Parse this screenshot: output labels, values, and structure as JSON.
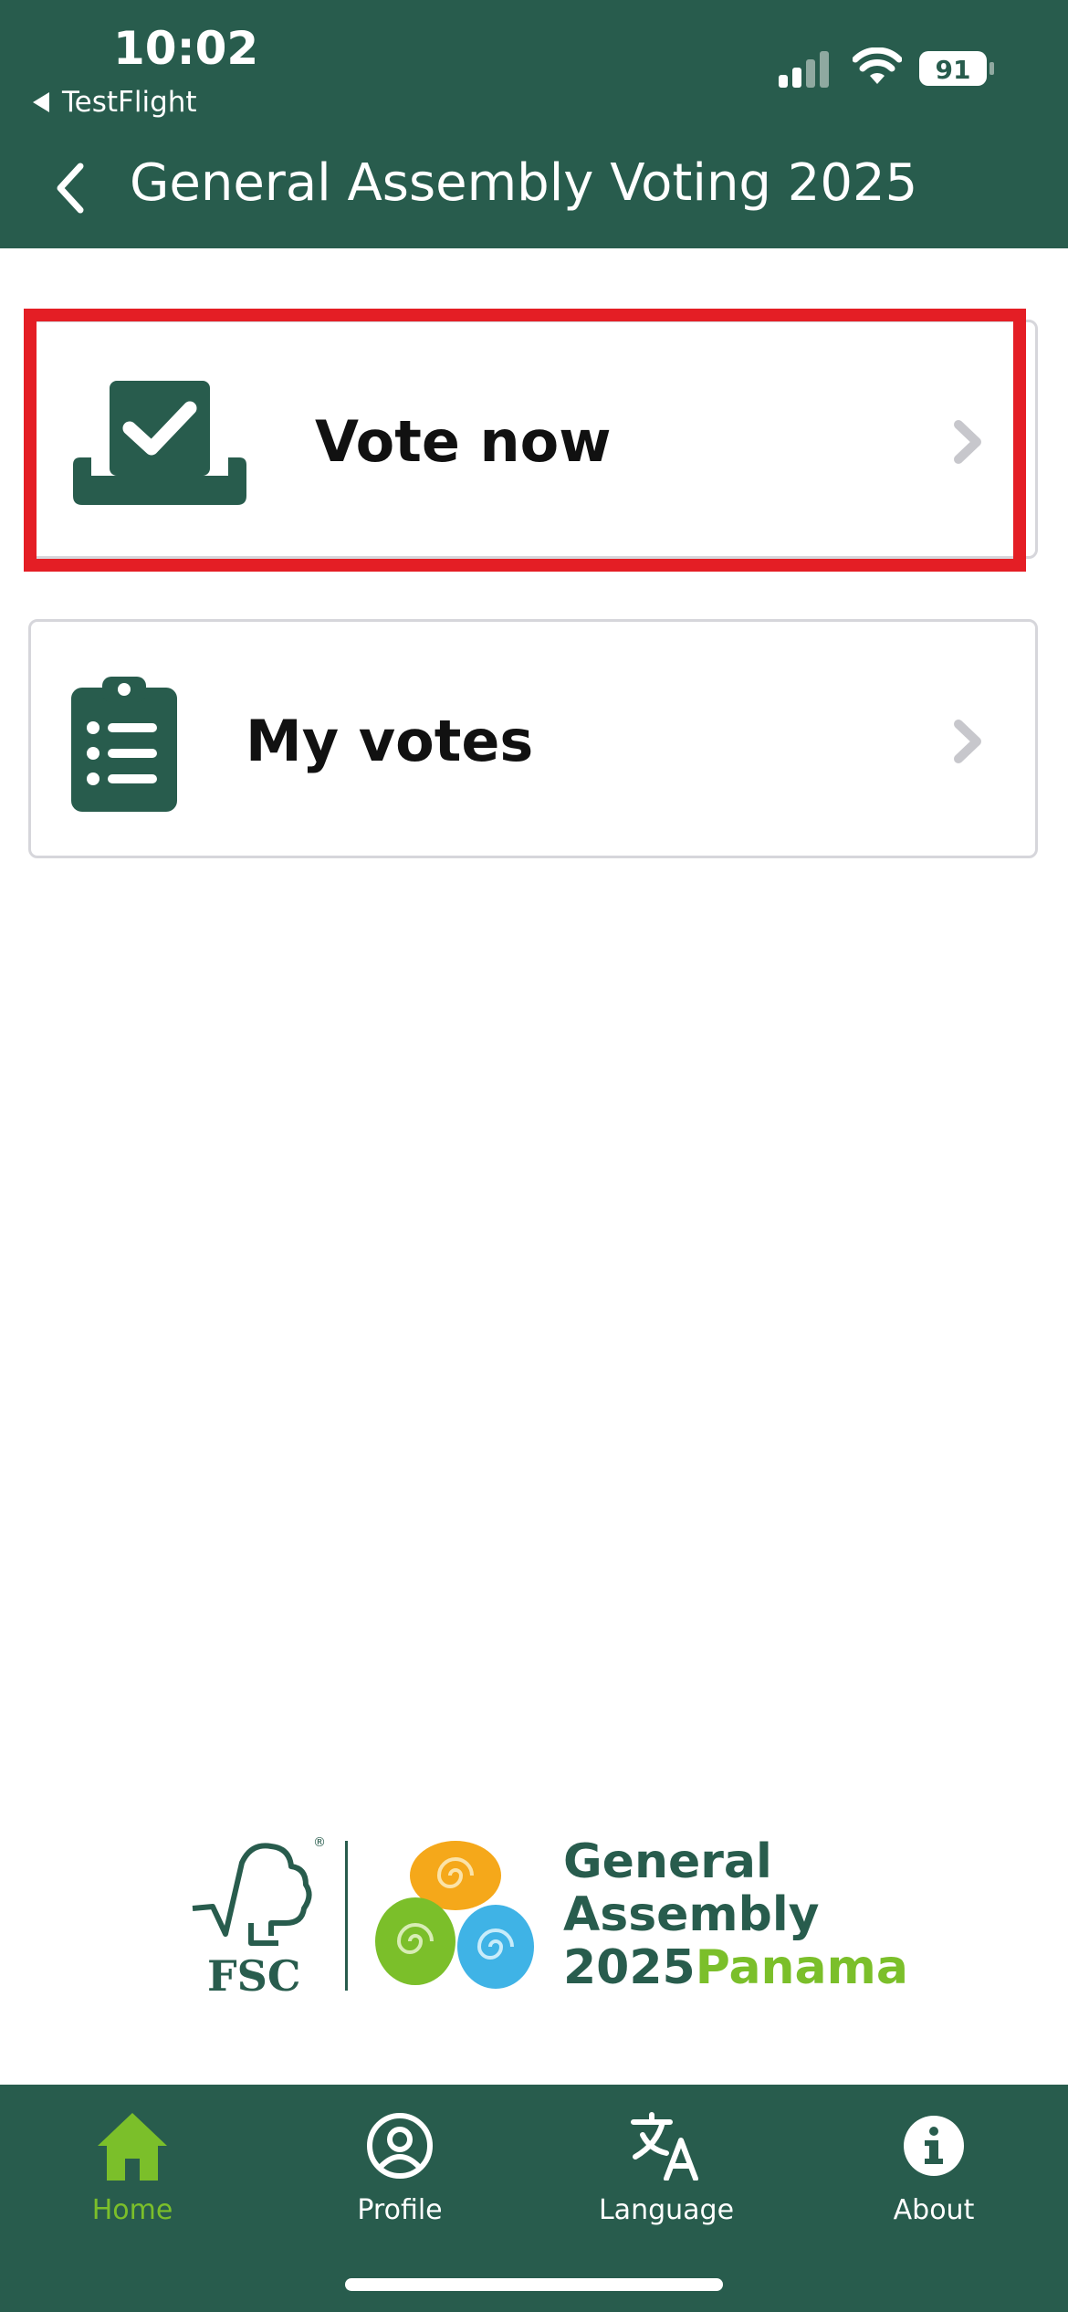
{
  "status_bar": {
    "time": "10:02",
    "back_app": "TestFlight",
    "battery": "91"
  },
  "header": {
    "title": "General Assembly Voting 2025",
    "back_icon": "chevron-left-icon"
  },
  "cards": [
    {
      "label": "Vote now",
      "icon": "ballot-box-icon"
    },
    {
      "label": "My votes",
      "icon": "clipboard-list-icon"
    }
  ],
  "logo": {
    "fsc": "FSC",
    "line1": "General",
    "line2": "Assembly",
    "year": "2025",
    "place": "Panama"
  },
  "tabbar": {
    "items": [
      {
        "label": "Home",
        "icon": "home-icon",
        "active": true
      },
      {
        "label": "Profile",
        "icon": "profile-icon",
        "active": false
      },
      {
        "label": "Language",
        "icon": "translate-icon",
        "active": false
      },
      {
        "label": "About",
        "icon": "info-icon",
        "active": false
      }
    ]
  },
  "colors": {
    "brand_green": "#285c4d",
    "accent_green": "#7bbf2a",
    "highlight_red": "#e41e25"
  }
}
